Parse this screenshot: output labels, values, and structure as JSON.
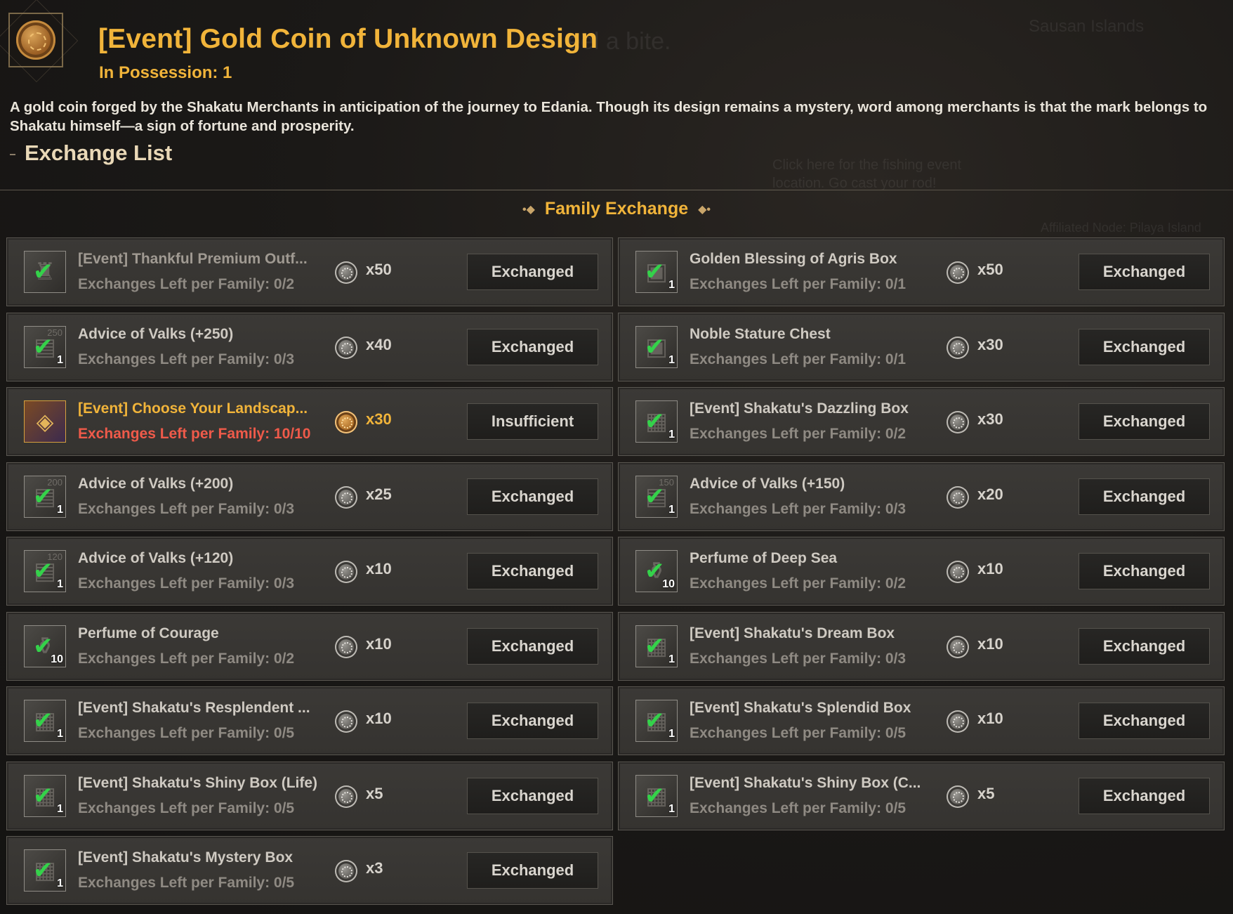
{
  "window": {
    "title": "[Event] Gold Coin of Unknown Design",
    "possession": "In Possession: 1",
    "description": "A gold coin forged by the Shakatu Merchants in anticipation of the journey to Edania. Though its design remains a mystery, word among merchants is that the mark belongs to Shakatu himself—a sign of fortune and prosperity.",
    "exchange_list_title": "Exchange List",
    "family_exchange_label": "Family Exchange",
    "coin_icon": "gold-coin-icon"
  },
  "background_map": {
    "place": "Sausan Islands",
    "hint": "Click here for the fishing event location. Go cast your rod!",
    "node": "Affiliated Node: Pilaya Island",
    "partial": "eel a bite."
  },
  "items": [
    {
      "name": "[Event] Thankful Premium Outf...",
      "left": "Exchanges Left per Family: 0/2",
      "cost": "x50",
      "button": "Exchanged",
      "qty": "",
      "state": "dim",
      "icon": "outfit-icon"
    },
    {
      "name": "Golden Blessing of Agris Box",
      "left": "Exchanges Left per Family: 0/1",
      "cost": "x50",
      "button": "Exchanged",
      "qty": "1",
      "state": "done",
      "icon": "chest-icon"
    },
    {
      "name": "Advice of Valks (+250)",
      "left": "Exchanges Left per Family: 0/3",
      "cost": "x40",
      "button": "Exchanged",
      "qty": "1",
      "state": "done",
      "icon": "book-icon",
      "ghost": "250"
    },
    {
      "name": "Noble Stature Chest",
      "left": "Exchanges Left per Family: 0/1",
      "cost": "x30",
      "button": "Exchanged",
      "qty": "1",
      "state": "done",
      "icon": "chest-icon"
    },
    {
      "name": "[Event] Choose Your Landscap...",
      "left": "Exchanges Left per Family: 10/10",
      "cost": "x30",
      "button": "Insufficient",
      "qty": "",
      "state": "available",
      "icon": "treasure-chest-icon"
    },
    {
      "name": "[Event] Shakatu's Dazzling Box",
      "left": "Exchanges Left per Family: 0/2",
      "cost": "x30",
      "button": "Exchanged",
      "qty": "1",
      "state": "done",
      "icon": "box-icon"
    },
    {
      "name": "Advice of Valks (+200)",
      "left": "Exchanges Left per Family: 0/3",
      "cost": "x25",
      "button": "Exchanged",
      "qty": "1",
      "state": "done",
      "icon": "book-icon",
      "ghost": "200"
    },
    {
      "name": "Advice of Valks (+150)",
      "left": "Exchanges Left per Family: 0/3",
      "cost": "x20",
      "button": "Exchanged",
      "qty": "1",
      "state": "done",
      "icon": "book-icon",
      "ghost": "150"
    },
    {
      "name": "Advice of Valks (+120)",
      "left": "Exchanges Left per Family: 0/3",
      "cost": "x10",
      "button": "Exchanged",
      "qty": "1",
      "state": "done",
      "icon": "book-icon",
      "ghost": "120"
    },
    {
      "name": "Perfume of Deep Sea",
      "left": "Exchanges Left per Family: 0/2",
      "cost": "x10",
      "button": "Exchanged",
      "qty": "10",
      "state": "done",
      "icon": "perfume-icon"
    },
    {
      "name": "Perfume of Courage",
      "left": "Exchanges Left per Family: 0/2",
      "cost": "x10",
      "button": "Exchanged",
      "qty": "10",
      "state": "done",
      "icon": "perfume-icon"
    },
    {
      "name": "[Event] Shakatu's Dream Box",
      "left": "Exchanges Left per Family: 0/3",
      "cost": "x10",
      "button": "Exchanged",
      "qty": "1",
      "state": "done",
      "icon": "box-icon"
    },
    {
      "name": "[Event] Shakatu's Resplendent ...",
      "left": "Exchanges Left per Family: 0/5",
      "cost": "x10",
      "button": "Exchanged",
      "qty": "1",
      "state": "done",
      "icon": "box-icon"
    },
    {
      "name": "[Event] Shakatu's Splendid Box",
      "left": "Exchanges Left per Family: 0/5",
      "cost": "x10",
      "button": "Exchanged",
      "qty": "1",
      "state": "done",
      "icon": "box-icon"
    },
    {
      "name": "[Event] Shakatu's Shiny Box (Life)",
      "left": "Exchanges Left per Family: 0/5",
      "cost": "x5",
      "button": "Exchanged",
      "qty": "1",
      "state": "done",
      "icon": "box-icon"
    },
    {
      "name": "[Event] Shakatu's Shiny Box (C...",
      "left": "Exchanges Left per Family: 0/5",
      "cost": "x5",
      "button": "Exchanged",
      "qty": "1",
      "state": "done",
      "icon": "box-icon"
    },
    {
      "name": "[Event] Shakatu's Mystery Box",
      "left": "Exchanges Left per Family: 0/5",
      "cost": "x3",
      "button": "Exchanged",
      "qty": "1",
      "state": "done",
      "icon": "box-icon"
    }
  ],
  "colors": {
    "accent_gold": "#f1b43a",
    "check_green": "#34d24a",
    "warning_red": "#ef5a4a"
  }
}
